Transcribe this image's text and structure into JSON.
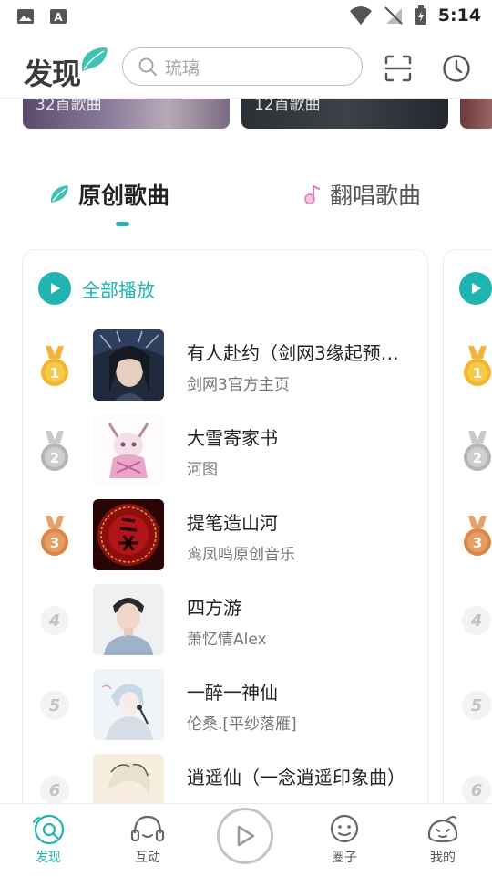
{
  "status_bar": {
    "time": "5:14"
  },
  "header": {
    "logo_text": "发现",
    "search_placeholder": "琉璃"
  },
  "banners": [
    {
      "label": "32首歌曲"
    },
    {
      "label": "12首歌曲"
    }
  ],
  "tabs": [
    {
      "label": "原创歌曲",
      "active": true
    },
    {
      "label": "翻唱歌曲",
      "active": false
    }
  ],
  "play_all_label": "全部播放",
  "songs": [
    {
      "rank": "1",
      "title": "有人赴约（剑网3缘起预…",
      "artist": "剑网3官方主页"
    },
    {
      "rank": "2",
      "title": "大雪寄家书",
      "artist": "河图"
    },
    {
      "rank": "3",
      "title": "提笔造山河",
      "artist": "鸾凤鸣原创音乐"
    },
    {
      "rank": "4",
      "title": "四方游",
      "artist": "萧忆情Alex"
    },
    {
      "rank": "5",
      "title": "一醉一神仙",
      "artist": "伦桑.[平纱落雁]"
    },
    {
      "rank": "6",
      "title": "逍遥仙（一念逍遥印象曲）",
      "artist": ""
    }
  ],
  "peek_ranks": [
    "1",
    "2",
    "3",
    "4",
    "5",
    "6"
  ],
  "bottom_nav": {
    "discover": "发现",
    "interact": "互动",
    "circle": "圈子",
    "mine": "我的"
  },
  "colors": {
    "accent": "#1fb3b1",
    "gold": "#e8a21f",
    "silver": "#b5b5b5",
    "bronze": "#d8864a"
  }
}
